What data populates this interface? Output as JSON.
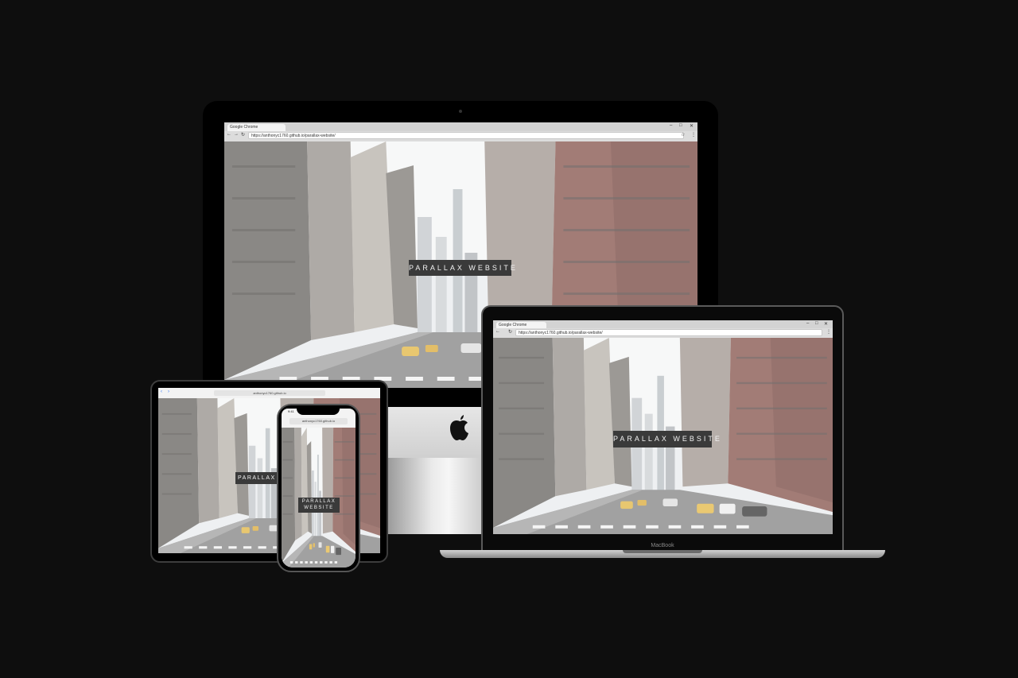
{
  "desktop": {
    "window_title": "Google Chrome",
    "url": "https://anthonyc1760.github.io/parallax-website/",
    "hero_text": "PARALLAX WEBSITE"
  },
  "laptop": {
    "window_title": "Google Chrome",
    "url": "https://anthonyc1760.github.io/parallax-website/",
    "hero_text": "PARALLAX WEBSITE",
    "brand": "MacBook"
  },
  "tablet": {
    "url": "anthonyc1760.github.io",
    "hero_text": "PARALLAX W"
  },
  "phone": {
    "time": "9:41",
    "url": "anthonyc1760.github.io",
    "hero_line1": "PARALLAX",
    "hero_line2": "WEBSITE"
  },
  "icons": {
    "apple_logo": "apple-logo-icon",
    "back": "back-arrow-icon",
    "forward": "forward-arrow-icon",
    "reload": "reload-icon",
    "star": "bookmark-star-icon",
    "menu": "kebab-menu-icon",
    "minimize": "minimize-icon",
    "maximize": "maximize-icon",
    "close": "close-icon"
  }
}
